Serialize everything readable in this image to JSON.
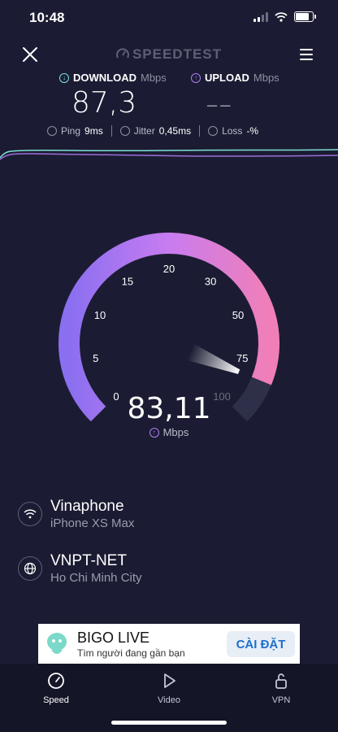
{
  "status": {
    "time": "10:48"
  },
  "header": {
    "brand": "SPEEDTEST"
  },
  "download": {
    "label": "DOWNLOAD",
    "unit": "Mbps",
    "value": "87,3"
  },
  "upload": {
    "label": "UPLOAD",
    "unit": "Mbps",
    "value": "––"
  },
  "stats": {
    "ping_label": "Ping",
    "ping_value": "9ms",
    "jitter_label": "Jitter",
    "jitter_value": "0,45ms",
    "loss_label": "Loss",
    "loss_value": "-%"
  },
  "gauge": {
    "value": "83,11",
    "unit": "Mbps",
    "reading": 83.11,
    "ticks": [
      "0",
      "5",
      "10",
      "15",
      "20",
      "30",
      "50",
      "75",
      "100"
    ]
  },
  "provider": {
    "name": "Vinaphone",
    "device": "iPhone XS Max"
  },
  "server": {
    "name": "VNPT-NET",
    "location": "Ho Chi Minh City"
  },
  "ad": {
    "title": "BIGO LIVE",
    "subtitle": "Tìm người đang gần bạn",
    "button": "CÀI ĐẶT"
  },
  "nav": {
    "speed": "Speed",
    "video": "Video",
    "vpn": "VPN"
  },
  "colors": {
    "background": "#1b1c33",
    "download": "#7fe0d6",
    "upload": "#b47cf2",
    "gauge_start": "#8a6ff0",
    "gauge_end": "#f07fb8"
  }
}
